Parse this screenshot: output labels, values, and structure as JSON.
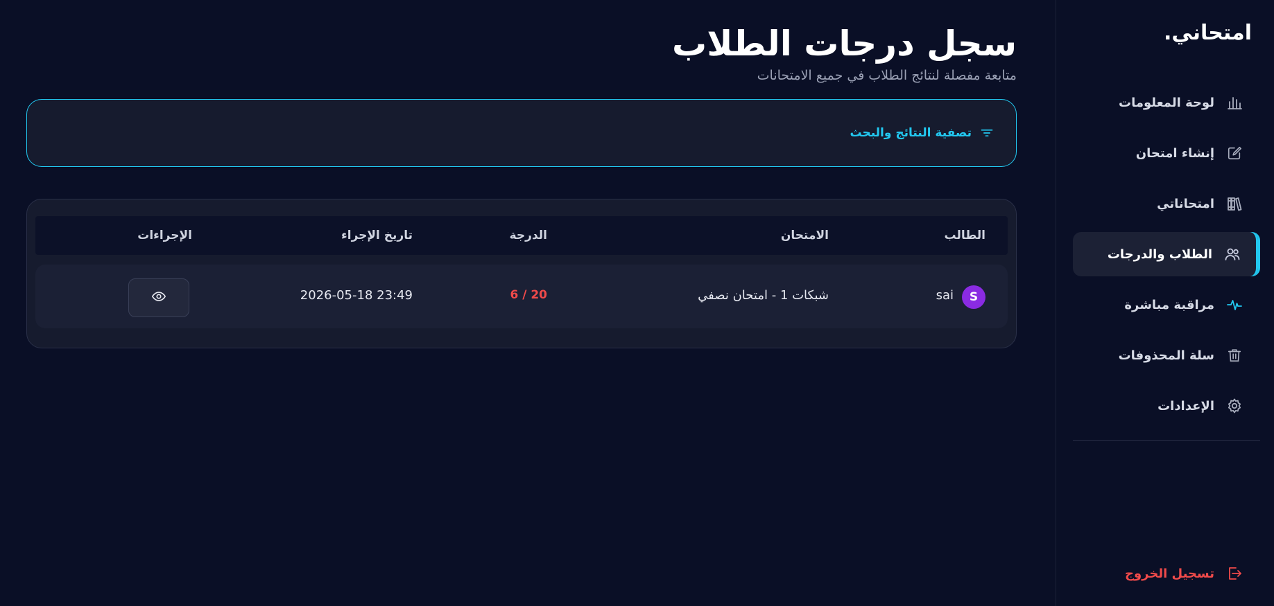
{
  "sidebar": {
    "logo": "امتحاني.",
    "items": [
      {
        "label": "لوحة المعلومات",
        "icon": "bar-chart-icon"
      },
      {
        "label": "إنشاء امتحان",
        "icon": "edit-square-icon"
      },
      {
        "label": "امتحاناتي",
        "icon": "library-icon"
      },
      {
        "label": "الطلاب والدرجات",
        "icon": "users-icon",
        "active": true
      },
      {
        "label": "مراقبة مباشرة",
        "icon": "activity-icon"
      },
      {
        "label": "سلة المحذوفات",
        "icon": "trash-icon"
      },
      {
        "label": "الإعدادات",
        "icon": "gear-icon"
      }
    ],
    "logout": "تسجيل الخروج"
  },
  "main": {
    "title": "سجل درجات الطلاب",
    "subtitle": "متابعة مفصلة لنتائج الطلاب في جميع الامتحانات",
    "filter_label": "تصفية النتائج والبحث"
  },
  "table": {
    "headers": {
      "student": "الطالب",
      "exam": "الامتحان",
      "score": "الدرجة",
      "date": "تاريخ الإجراء",
      "actions": "الإجراءات"
    },
    "rows": [
      {
        "avatar": "S",
        "student": "sai",
        "exam": "شبكات 1 - امتحان نصفي",
        "score": "20 / 6",
        "date": "2026-05-18 23:49"
      }
    ]
  },
  "colors": {
    "accent": "#22c8f0",
    "danger": "#f04a4a",
    "avatar": "#8a2be2",
    "background": "#0a0f26"
  }
}
